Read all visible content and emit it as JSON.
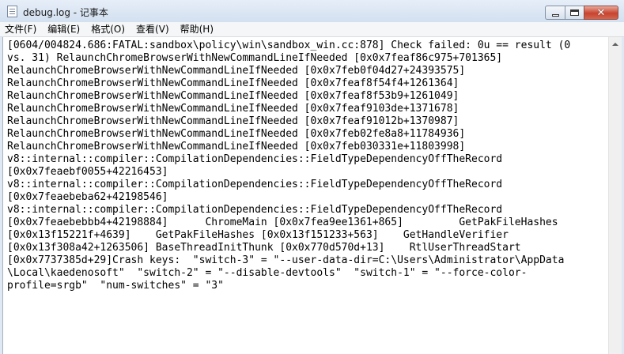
{
  "window": {
    "title": "debug.log - 记事本",
    "minimize_icon": "minimize-icon",
    "maximize_icon": "maximize-icon",
    "close_icon": "close-icon",
    "close_color": "#c8442f"
  },
  "menu": {
    "file": "文件(F)",
    "edit": "编辑(E)",
    "format": "格式(O)",
    "view": "查看(V)",
    "help": "帮助(H)"
  },
  "editor": {
    "lines": [
      "[0604/004824.686:FATAL:sandbox\\policy\\win\\sandbox_win.cc:878] Check failed: 0u == result (0",
      "vs. 31) RelaunchChromeBrowserWithNewCommandLineIfNeeded [0x0x7feaf86c975+701365]",
      "RelaunchChromeBrowserWithNewCommandLineIfNeeded [0x0x7feb0f04d27+24393575]",
      "RelaunchChromeBrowserWithNewCommandLineIfNeeded [0x0x7feaf8f54f4+1261364]",
      "RelaunchChromeBrowserWithNewCommandLineIfNeeded [0x0x7feaf8f53b9+1261049]",
      "RelaunchChromeBrowserWithNewCommandLineIfNeeded [0x0x7feaf9103de+1371678]",
      "RelaunchChromeBrowserWithNewCommandLineIfNeeded [0x0x7feaf91012b+1370987]",
      "RelaunchChromeBrowserWithNewCommandLineIfNeeded [0x0x7feb02fe8a8+11784936]",
      "RelaunchChromeBrowserWithNewCommandLineIfNeeded [0x0x7feb030331e+11803998]",
      "v8::internal::compiler::CompilationDependencies::FieldTypeDependencyOffTheRecord",
      "[0x0x7feaebf0055+42216453]",
      "v8::internal::compiler::CompilationDependencies::FieldTypeDependencyOffTheRecord",
      "[0x0x7feaebeba62+42198546]",
      "v8::internal::compiler::CompilationDependencies::FieldTypeDependencyOffTheRecord",
      "[0x0x7feaebebbb4+42198884]      ChromeMain [0x0x7fea9ee1361+865]         GetPakFileHashes",
      "[0x0x13f15221f+4639]    GetPakFileHashes [0x0x13f151233+563]    GetHandleVerifier",
      "[0x0x13f308a42+1263506] BaseThreadInitThunk [0x0x770d570d+13]    RtlUserThreadStart",
      "[0x0x7737385d+29]Crash keys:  \"switch-3\" = \"--user-data-dir=C:\\Users\\Administrator\\AppData",
      "\\Local\\kaedenosoft\"  \"switch-2\" = \"--disable-devtools\"  \"switch-1\" = \"--force-color-",
      "profile=srgb\"  \"num-switches\" = \"3\""
    ]
  },
  "scrollbar": {
    "up_icon": "scroll-up-arrow-icon"
  }
}
